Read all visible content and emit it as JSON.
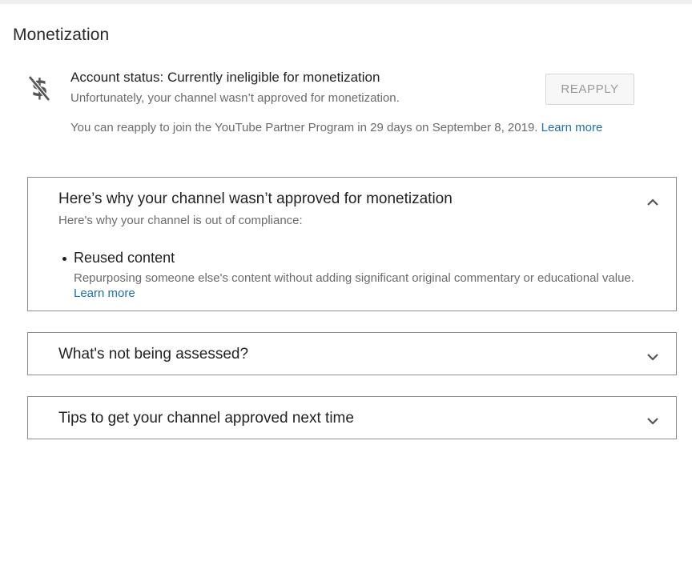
{
  "page": {
    "title": "Monetization"
  },
  "account_status": {
    "title": "Account status: Currently ineligible for monetization",
    "subtitle": "Unfortunately, your channel wasn’t approved for monetization.",
    "reapply_button": "REAPPLY",
    "reapply_note": "You can reapply to join the YouTube Partner Program in 29 days on September 8, 2019.",
    "learn_more": "Learn more",
    "icon": "no-money-icon"
  },
  "panels": [
    {
      "heading": "Here’s why your channel wasn’t approved for monetization",
      "subheading": "Here's why your channel is out of compliance:",
      "expanded": true,
      "reasons": [
        {
          "title": "Reused content",
          "description": "Repurposing someone else's content without adding significant original commentary or educational value.",
          "learn_more": "Learn more"
        }
      ]
    },
    {
      "heading": "What's not being assessed?",
      "expanded": false
    },
    {
      "heading": "Tips to get your channel approved next time",
      "expanded": false
    }
  ],
  "colors": {
    "link": "#1a6fb5",
    "border": "#8c8c8c",
    "button_bg": "#f7f7f7",
    "button_text": "#9a9a9a"
  }
}
